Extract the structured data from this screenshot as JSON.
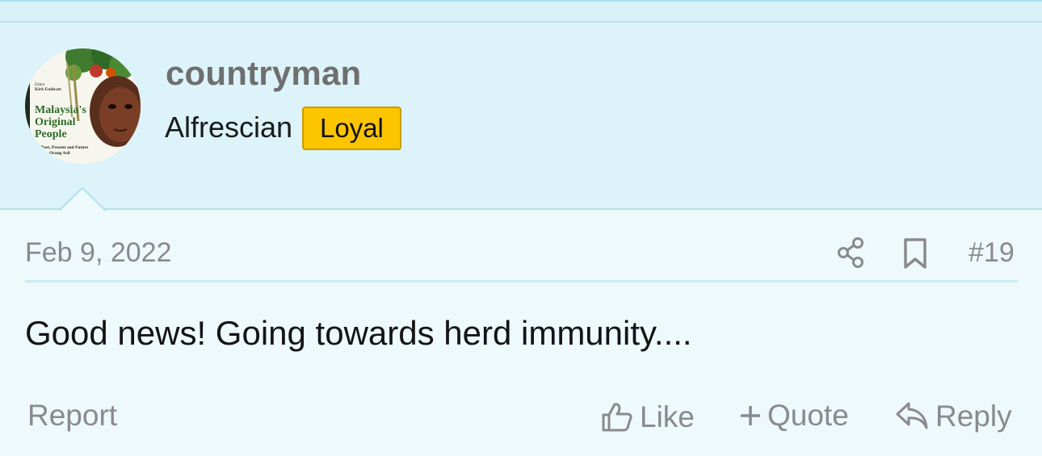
{
  "user": {
    "username": "countryman",
    "title": "Alfrescian",
    "badge": "Loyal",
    "avatar": {
      "alt": "avatar",
      "text_lines": [
        "Editor",
        "Kirk Endicott",
        "Malaysia's",
        "Original",
        "People",
        "Past, Present and Future",
        "Orang Asli"
      ]
    }
  },
  "post": {
    "date": "Feb 9, 2022",
    "number": "#19",
    "body": "Good news! Going towards herd immunity...."
  },
  "actions": {
    "report": "Report",
    "like": "Like",
    "quote": "Quote",
    "reply": "Reply"
  },
  "icons": {
    "share": "share-icon",
    "bookmark": "bookmark-icon",
    "like": "thumbs-up-icon",
    "quote": "plus-icon",
    "reply": "reply-icon"
  },
  "colors": {
    "panel_bg": "#dcf3f9",
    "post_bg": "#eef9fc",
    "badge_bg": "#fdc400",
    "muted_text": "#8a8a8a",
    "username": "#6f6f6f"
  }
}
